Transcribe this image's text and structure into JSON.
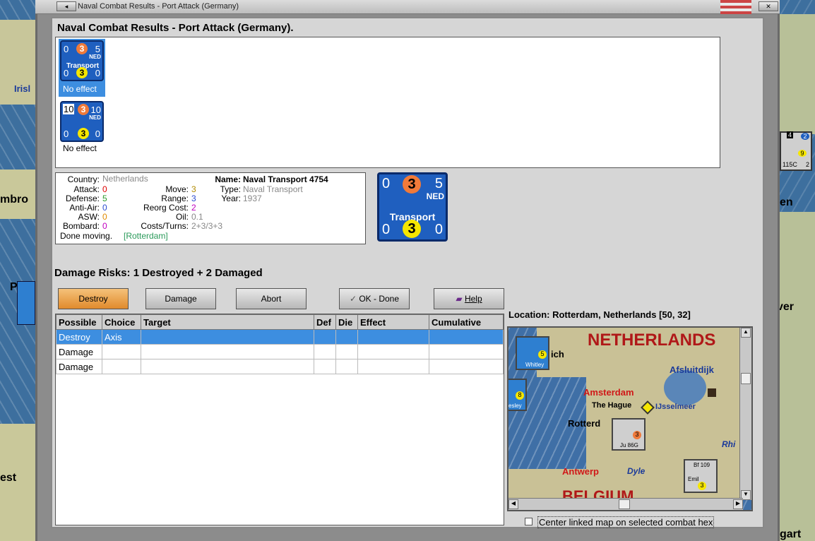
{
  "window": {
    "title": "Naval Combat Results - Port Attack (Germany)"
  },
  "dialog": {
    "heading": "Naval Combat Results - Port Attack (Germany)."
  },
  "units": [
    {
      "left_top": "0",
      "center_top": "3",
      "right_top": "5",
      "nation": "NED",
      "type": "Transport",
      "left_bottom": "0",
      "center_bottom": "3",
      "right_bottom": "0",
      "status": "No effect"
    },
    {
      "left_top": "10",
      "center_top": "3",
      "right_top": "10",
      "nation": "NED",
      "type": "",
      "left_bottom": "0",
      "center_bottom": "3",
      "right_bottom": "0",
      "status": "No effect"
    }
  ],
  "info": {
    "country_label": "Country:",
    "country": "Netherlands",
    "attack_label": "Attack:",
    "attack": "0",
    "defense_label": "Defense:",
    "defense": "5",
    "antiair_label": "Anti-Air:",
    "antiair": "0",
    "asw_label": "ASW:",
    "asw": "0",
    "bombard_label": "Bombard:",
    "bombard": "0",
    "move_label": "Move:",
    "move": "3",
    "range_label": "Range:",
    "range": "3",
    "reorg_label": "Reorg Cost:",
    "reorg": "2",
    "oil_label": "Oil:",
    "oil": "0.1",
    "costs_label": "Costs/Turns:",
    "costs": "2+3/3+3",
    "name_label": "Name:",
    "name": "Naval Transport 4754",
    "type_label": "Type:",
    "type": "Naval Transport",
    "year_label": "Year:",
    "year": "1937",
    "moving_label": "Done moving.",
    "location": "[Rotterdam]"
  },
  "big_counter": {
    "left_top": "0",
    "center_top": "3",
    "right_top": "5",
    "nation": "NED",
    "type": "Transport",
    "left_bottom": "0",
    "center_bottom": "3",
    "right_bottom": "0"
  },
  "damage": {
    "heading": "Damage Risks:  1 Destroyed + 2 Damaged"
  },
  "buttons": {
    "destroy": "Destroy",
    "damage": "Damage",
    "abort": "Abort",
    "ok": "OK - Done",
    "help": "Help"
  },
  "table": {
    "headers": [
      "Possible",
      "Choice",
      "Target",
      "Def",
      "Die",
      "Effect",
      "Cumulative"
    ],
    "rows": [
      [
        "Destroy",
        "Axis",
        "",
        "",
        "",
        "",
        ""
      ],
      [
        "Damage",
        "",
        "",
        "",
        "",
        "",
        ""
      ],
      [
        "Damage",
        "",
        "",
        "",
        "",
        "",
        ""
      ]
    ]
  },
  "location": {
    "label": "Location:  Rotterdam, Netherlands [50, 32]"
  },
  "minimap": {
    "netherlands": "NETHERLANDS",
    "afsluitdijk": "Afsluitdijk",
    "amsterdam": "Amsterdam",
    "the_hague": "The Hague",
    "ijsselmeer": "IJsselmeer",
    "rotterdam": "Rotterd",
    "rhine": "Rhi",
    "antwerp": "Antwerp",
    "dyle": "Dyle",
    "belgium": "BELGIUM",
    "norwich": "ich",
    "c1": "Whitley",
    "c1n": "5",
    "c2n": "8",
    "c2": "esley",
    "c3": "Ju 86G",
    "c3n": "3",
    "c4": "Bf 109",
    "c4b": "Emil",
    "c4n": "3"
  },
  "checkbox": {
    "label": "Center linked map on selected combat hex",
    "checked": false
  },
  "background": {
    "irish": "Irisl",
    "mbro": "mbro",
    "est": "est",
    "p": "P",
    "en": "en",
    "ver": "ver",
    "gart": "gart",
    "r1": "4",
    "r2": "2",
    "r3": "9",
    "r4": "115C",
    "r5": "2"
  },
  "colors": {
    "counter_blue": "#1f5fbf",
    "selection": "#3d8ee0",
    "destroy_orange": "#e08a2c"
  }
}
